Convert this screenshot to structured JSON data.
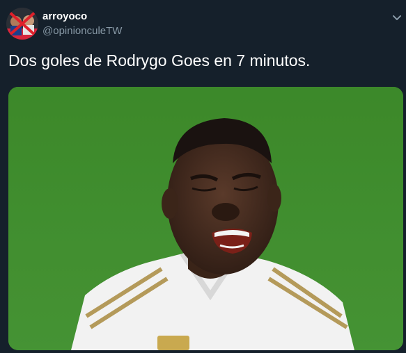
{
  "tweet": {
    "display_name": "arroyoco",
    "handle": "@opinionculeTW",
    "text": "Dos goles de Rodrygo Goes en 7 minutos."
  },
  "icons": {
    "menu": "chevron-down-icon"
  },
  "colors": {
    "background": "#15202b",
    "secondary_text": "#8899a6",
    "pitch_green": "#3f8a2c",
    "kit_white": "#f2f2f2",
    "kit_gold": "#b49a5a"
  }
}
